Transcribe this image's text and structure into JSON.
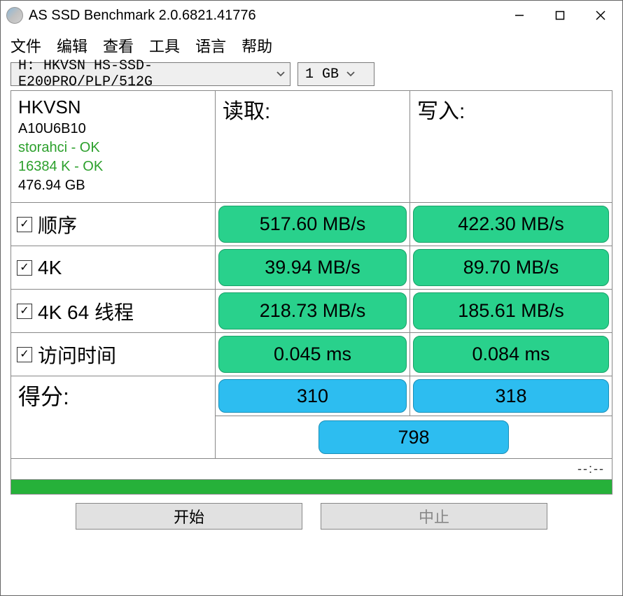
{
  "window": {
    "title": "AS SSD Benchmark 2.0.6821.41776"
  },
  "menu": {
    "file": "文件",
    "edit": "编辑",
    "view": "查看",
    "tools": "工具",
    "language": "语言",
    "help": "帮助"
  },
  "drive": {
    "value": "H: HKVSN HS-SSD-E200PRO/PLP/512G"
  },
  "size": {
    "value": "1 GB"
  },
  "info": {
    "model": "HKVSN",
    "firmware": "A10U6B10",
    "driver": "storahci - OK",
    "align": "16384 K - OK",
    "capacity": "476.94 GB"
  },
  "heads": {
    "read": "读取:",
    "write": "写入:"
  },
  "rows": {
    "seq": {
      "label": "顺序",
      "read": "517.60 MB/s",
      "write": "422.30 MB/s"
    },
    "k4": {
      "label": "4K",
      "read": "39.94 MB/s",
      "write": "89.70 MB/s"
    },
    "k4_64": {
      "label": "4K 64 线程",
      "read": "218.73 MB/s",
      "write": "185.61 MB/s"
    },
    "acc": {
      "label": "访问时间",
      "read": "0.045 ms",
      "write": "0.084 ms"
    }
  },
  "score": {
    "label": "得分:",
    "read": "310",
    "write": "318",
    "total": "798"
  },
  "progress": {
    "text": "--:--"
  },
  "buttons": {
    "start": "开始",
    "stop": "中止"
  },
  "colors": {
    "green_pill": "#29d18c",
    "blue_pill": "#2dbdf0",
    "ok_text": "#2ca02c",
    "bar": "#26b13a"
  },
  "chart_data": {
    "type": "table",
    "title": "AS SSD Benchmark Results",
    "categories": [
      "顺序",
      "4K",
      "4K 64 线程",
      "访问时间",
      "得分"
    ],
    "series": [
      {
        "name": "读取",
        "values": [
          "517.60 MB/s",
          "39.94 MB/s",
          "218.73 MB/s",
          "0.045 ms",
          310
        ]
      },
      {
        "name": "写入",
        "values": [
          "422.30 MB/s",
          "89.70 MB/s",
          "185.61 MB/s",
          "0.084 ms",
          318
        ]
      }
    ],
    "total_score": 798
  }
}
